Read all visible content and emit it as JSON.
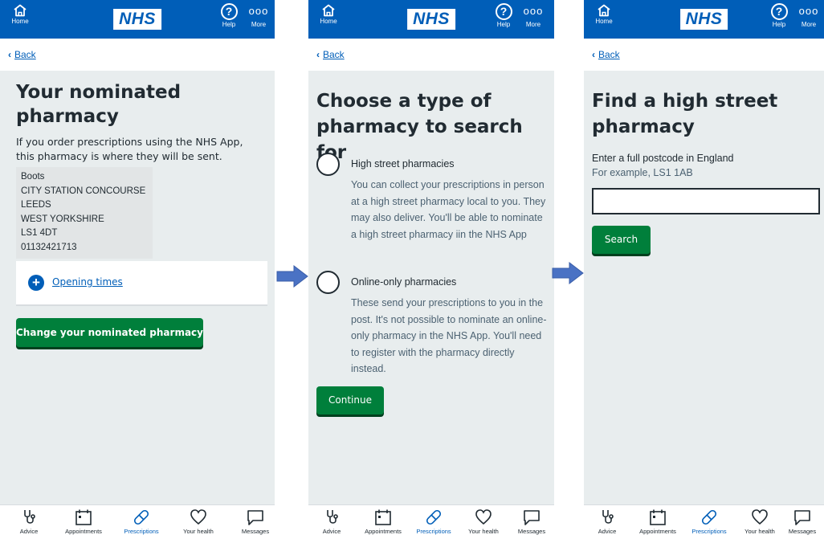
{
  "topbar": {
    "home_label": "Home",
    "logo": "NHS",
    "help_label": "Help",
    "more_label": "More",
    "help_glyph": "?",
    "more_glyph": "ooo"
  },
  "nav": {
    "items": [
      {
        "label": "Advice",
        "icon": "stethoscope-icon"
      },
      {
        "label": "Appointments",
        "icon": "calendar-icon"
      },
      {
        "label": "Prescriptions",
        "icon": "pill-icon",
        "active": true
      },
      {
        "label": "Your health",
        "icon": "heart-icon"
      },
      {
        "label": "Messages",
        "icon": "message-icon"
      }
    ]
  },
  "back_label": "Back",
  "screen1": {
    "title": "Your nominated pharmacy",
    "intro": "If you order prescriptions using the NHS App, this pharmacy is where they will be sent.",
    "address": [
      "Boots",
      "CITY STATION CONCOURSE",
      "LEEDS",
      "WEST YORKSHIRE",
      "LS1 4DT",
      "01132421713"
    ],
    "opening_times_label": "Opening times",
    "change_button": "Change your nominated pharmacy"
  },
  "screen2": {
    "title": "Choose a type of pharmacy to search for",
    "options": [
      {
        "label": "High street pharmacies",
        "hint": "You can collect your prescriptions in person at a high street pharmacy local to you. They may also deliver. You'll be able to nominate a high street pharmacy iin the NHS App"
      },
      {
        "label": "Online-only pharmacies",
        "hint": "These send your prescriptions to you in the post. It's not possible to nominate an online-only pharmacy in the NHS App. You'll need to register with the pharmacy directly instead."
      }
    ],
    "continue_button": "Continue"
  },
  "screen3": {
    "title": "Find a high street pharmacy",
    "label": "Enter a full postcode in England",
    "hint": "For example, LS1 1AB",
    "input_value": "",
    "search_button": "Search"
  },
  "colors": {
    "nhs_blue": "#005eb8",
    "button_green": "#007f3b",
    "background": "#e8edee",
    "arrow": "#4a72c4"
  }
}
